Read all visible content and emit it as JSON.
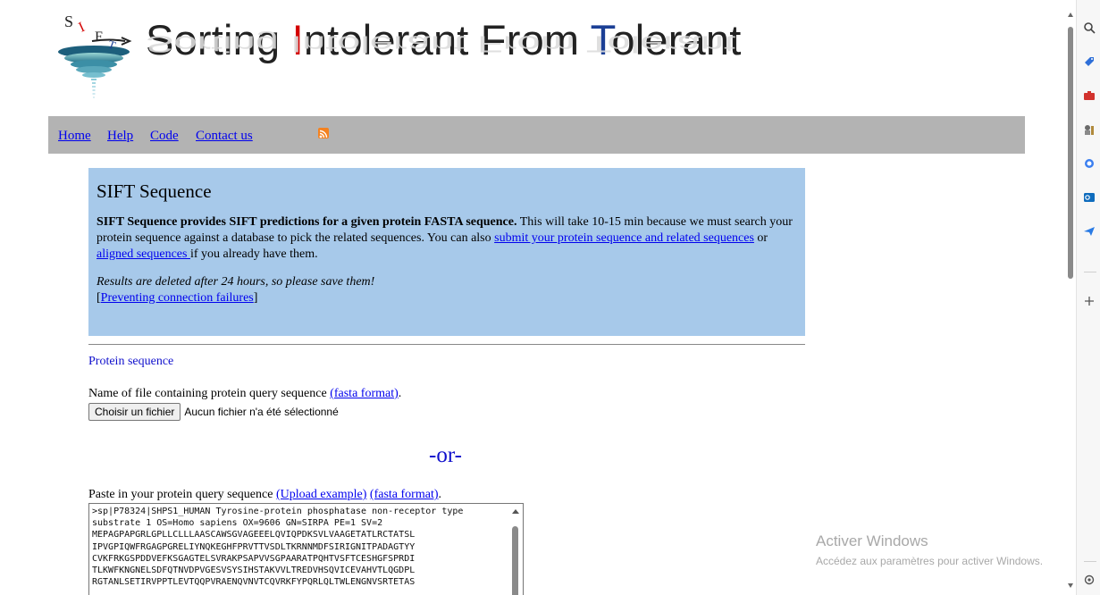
{
  "banner": {
    "logo_letters": [
      "S",
      "I",
      "F",
      "T"
    ],
    "title_parts": [
      {
        "text": "Sorting "
      },
      {
        "text": "I",
        "hl": "red"
      },
      {
        "text": "ntolerant From "
      },
      {
        "text": "T",
        "hl": "blue"
      },
      {
        "text": "olerant"
      }
    ]
  },
  "nav": {
    "home": "Home",
    "help": "Help",
    "code": "Code",
    "contact": "Contact us",
    "rss_icon": "rss-feed-icon"
  },
  "info": {
    "title": "SIFT Sequence",
    "bold_intro": "SIFT Sequence provides SIFT predictions for a given protein FASTA sequence.",
    "text_a": " This will take 10-15 min because we must search your protein sequence against a database to pick the related sequences. You can also ",
    "link_related": "submit your protein sequence and related sequences",
    "text_b": " or ",
    "link_aligned": "aligned sequences ",
    "text_c": "if you already have them.",
    "note_italic": "Results are deleted after 24 hours, so please save them!",
    "bracket_open": "[",
    "link_preventing": "Preventing connection failures",
    "bracket_close": "]"
  },
  "form": {
    "section_label": "Protein sequence",
    "file_label_text": "Name of file containing protein query sequence ",
    "file_fasta_link": "(fasta format)",
    "file_label_period": ".",
    "file_button": "Choisir un fichier",
    "file_status": "Aucun fichier n'a été sélectionné",
    "or_separator": "-or-",
    "paste_label_text": "Paste in your protein query sequence ",
    "upload_example_link": "(Upload example)",
    "paste_fasta_link": "(fasta format)",
    "paste_period": ".",
    "sequence_lines": [
      ">sp|P78324|SHPS1_HUMAN Tyrosine-protein phosphatase non-receptor type",
      "substrate 1 OS=Homo sapiens OX=9606 GN=SIRPA PE=1 SV=2",
      "MEPAGPAPGRLGPLLCLLLAASCAWSGVAGEEELQVIQPDKSVLVAAGETATLRCTATSL",
      "IPVGPIQWFRGAGPGRELIYNQKEGHFPRVTTVSDLTKRNNMDFSIRIGNITPADAGTYY",
      "CVKFRKGSPDDVEFKSGAGTELSVRAKPSAPVVSGPAARATPQHTVSFTCESHGFSPRDI",
      "TLKWFKNGNELSDFQTNVDPVGESVSYSIHSTAKVVLTREDVHSQVICEVAHVTLQGDPL",
      "RGTANLSETIRVPPTLEVTQQPVRAENQVNVTCQVRKFYPQRLQLTWLENGNVSRTETAS"
    ]
  },
  "watermark": {
    "title": "Activer Windows",
    "subtitle": "Accédez aux paramètres pour activer Windows."
  },
  "sidebar_icons": [
    "search-icon",
    "tag-icon",
    "briefcase-icon",
    "games-icon",
    "copilot-icon",
    "outlook-icon",
    "send-icon",
    "add-icon",
    "settings-icon"
  ],
  "colors": {
    "nav_bg": "#b3b3b3",
    "info_bg": "#a7c9ea",
    "link": "#0000ee",
    "accent_red": "#d40000",
    "accent_blue": "#1b3f95"
  }
}
